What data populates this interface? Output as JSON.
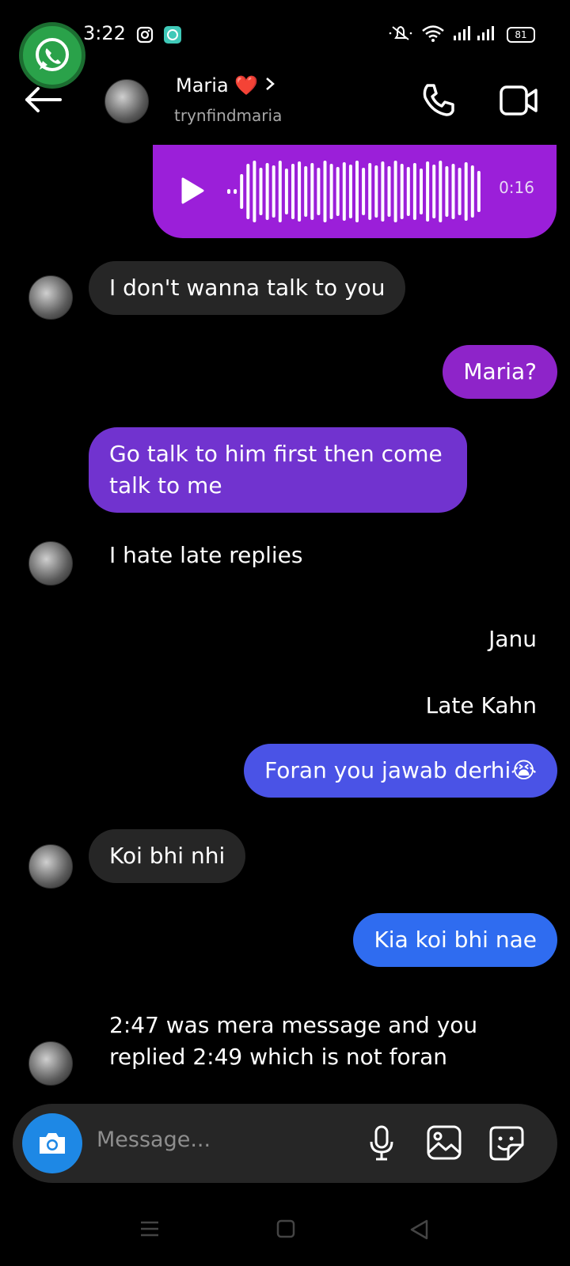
{
  "status_bar": {
    "time": "3:22",
    "battery": "81",
    "icons": [
      "whatsapp-bubble-icon",
      "instagram-icon",
      "chat-app-icon",
      "mute-icon",
      "wifi-icon",
      "signal-icon"
    ]
  },
  "header": {
    "name": "Maria ❤️",
    "username": "trynfindmaria"
  },
  "voice_message": {
    "duration": "0:16"
  },
  "messages": [
    {
      "text": "I don't wanna talk to you"
    },
    {
      "text": "Maria?"
    },
    {
      "text": "Go talk to him first then come talk to me"
    },
    {
      "text": "I hate late replies"
    },
    {
      "text": "Janu"
    },
    {
      "text": "Late Kahn"
    },
    {
      "text": "Foran you jawab derhi😭"
    },
    {
      "text": "Koi bhi nhi"
    },
    {
      "text": "Kia koi bhi nae"
    },
    {
      "text": "2:47 was mera message and you replied 2:49 which is not foran"
    }
  ],
  "composer": {
    "placeholder": "Message..."
  },
  "colors": {
    "voice_bubble": "#9b1fd9",
    "outgoing_purple": "#8e24c9",
    "outgoing_violet": "#7133cf",
    "outgoing_blue": "#4a53e6",
    "outgoing_bright_blue": "#2f6cf0",
    "incoming": "#262626",
    "camera_button": "#1e88e5"
  }
}
